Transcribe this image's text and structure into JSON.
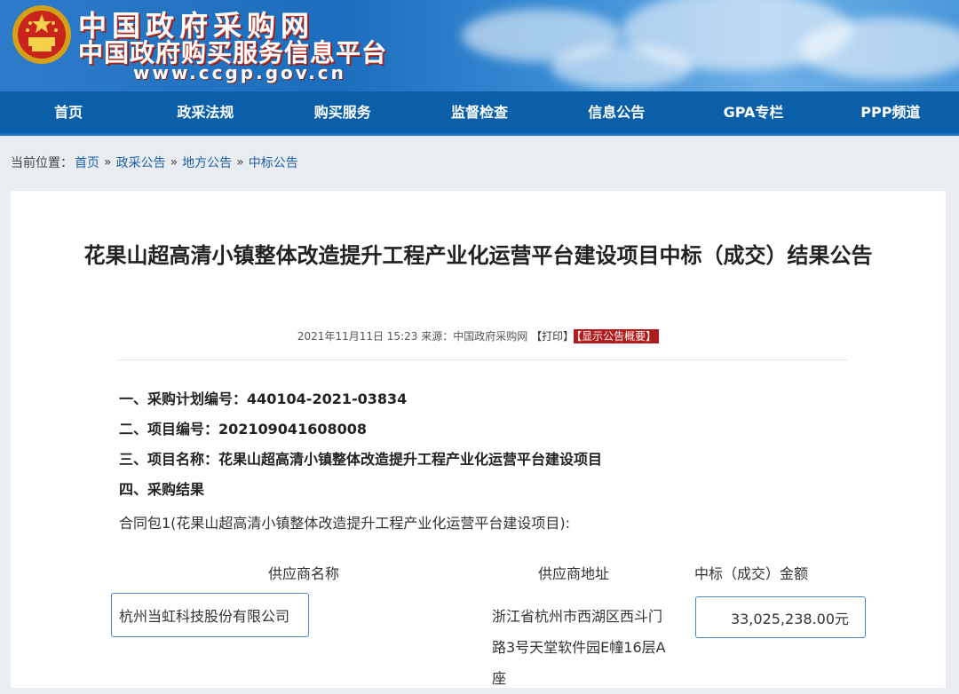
{
  "header": {
    "site_name": "中国政府采购网",
    "site_sub": "中国政府购买服务信息平台",
    "site_url": "www.ccgp.gov.cn"
  },
  "nav": [
    "首页",
    "政采法规",
    "购买服务",
    "监督检查",
    "信息公告",
    "GPA专栏",
    "PPP频道"
  ],
  "breadcrumb": {
    "prefix": "当前位置：",
    "items": [
      "首页",
      "政采公告",
      "地方公告",
      "中标公告"
    ],
    "sep": "»"
  },
  "article": {
    "title": "花果山超高清小镇整体改造提升工程产业化运营平台建设项目中标（成交）结果公告",
    "meta_date": "2021年11月11日 15:23",
    "meta_source": "来源：中国政府采购网",
    "meta_print": "【打印】",
    "meta_summary": "【显示公告概要】",
    "line1": "一、采购计划编号：440104-2021-03834",
    "line2": "二、项目编号：202109041608008",
    "line3": "三、项目名称：花果山超高清小镇整体改造提升工程产业化运营平台建设项目",
    "line4": "四、采购结果",
    "package": "合同包1(花果山超高清小镇整体改造提升工程产业化运营平台建设项目):",
    "col_supplier": "供应商名称",
    "col_address": "供应商地址",
    "col_amount": "中标（成交）金额",
    "supplier": "杭州当虹科技股份有限公司",
    "address": "浙江省杭州市西湖区西斗门路3号天堂软件园E幢16层A座",
    "amount": "33,025,238.00元"
  },
  "colors": {
    "nav": "#0b5fa8",
    "summary_badge": "#b01b1b",
    "highlight_border": "#4a86c8"
  }
}
